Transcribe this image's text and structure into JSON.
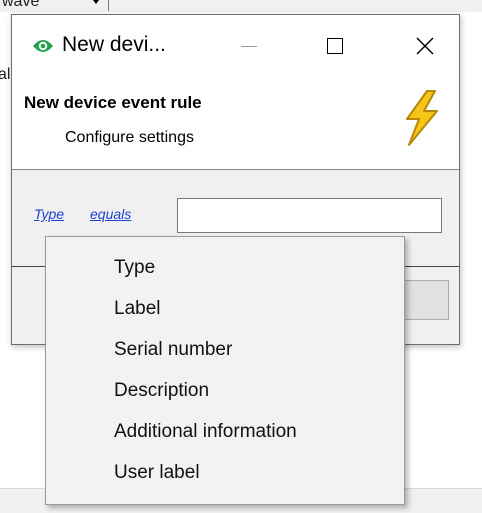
{
  "background": {
    "dropdown_partial_text": "wave",
    "left_partial_letter": "al"
  },
  "dialog": {
    "window_title": "New devi...",
    "header_title": "New device event rule",
    "header_subtitle": "Configure settings",
    "rule": {
      "field_link": "Type",
      "operator_link": "equals",
      "value": ""
    }
  },
  "menu": {
    "items": [
      {
        "label": "Type"
      },
      {
        "label": "Label"
      },
      {
        "label": "Serial number"
      },
      {
        "label": "Description"
      },
      {
        "label": "Additional information"
      },
      {
        "label": "User label"
      }
    ]
  },
  "icons": {
    "app": "eye-icon",
    "minimize": "minimize-icon",
    "maximize": "maximize-icon",
    "close": "close-icon",
    "header": "lightning-icon"
  },
  "colors": {
    "app_icon": "#23a24d",
    "link": "#1a44cc",
    "lightning_fill": "#f5c518",
    "lightning_outline": "#b8860b"
  }
}
